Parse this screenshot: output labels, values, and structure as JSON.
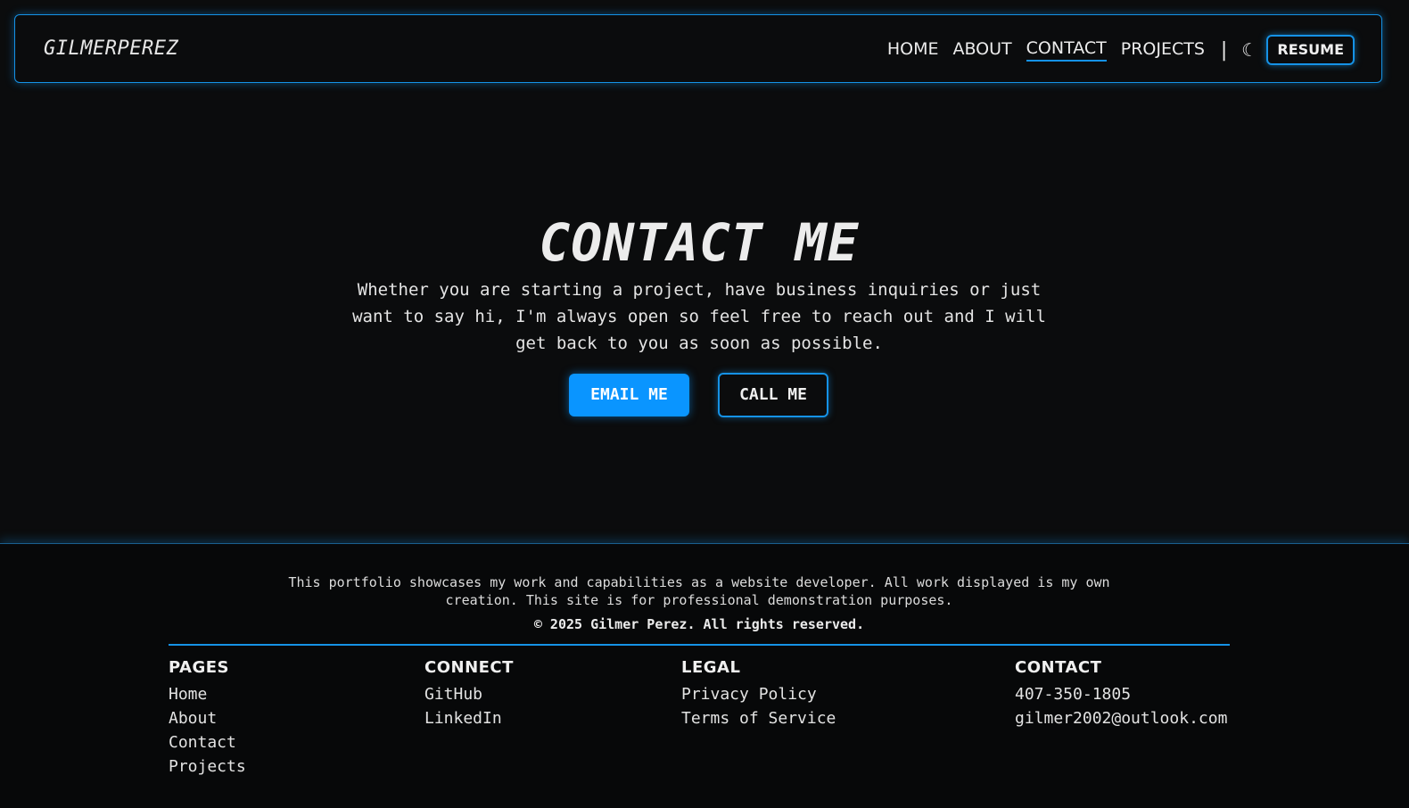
{
  "nav": {
    "brand": "GILMERPEREZ",
    "links": [
      "HOME",
      "ABOUT",
      "CONTACT",
      "PROJECTS"
    ],
    "active": "CONTACT",
    "separator": "|",
    "theme_icon": "moon-icon",
    "resume_label": "RESUME"
  },
  "hero": {
    "title": "CONTACT ME",
    "text": "Whether you are starting a project, have business inquiries or just want to say hi, I'm always open so feel free to reach out and I will get back to you as soon as possible.",
    "email_label": "EMAIL ME",
    "call_label": "CALL ME"
  },
  "footer": {
    "note": "This portfolio showcases my work and capabilities as a website developer. All work displayed is my own creation. This site is for professional demonstration purposes.",
    "copyright": "© 2025 Gilmer Perez. All rights reserved.",
    "columns": [
      {
        "heading": "PAGES",
        "items": [
          "Home",
          "About",
          "Contact",
          "Projects"
        ]
      },
      {
        "heading": "CONNECT",
        "items": [
          "GitHub",
          "LinkedIn"
        ]
      },
      {
        "heading": "LEGAL",
        "items": [
          "Privacy Policy",
          "Terms of Service"
        ]
      },
      {
        "heading": "CONTACT",
        "items": [
          "407-350-1805",
          "gilmer2002@outlook.com"
        ]
      }
    ]
  },
  "colors": {
    "accent": "#1592e6",
    "primary_button": "#0a95ff",
    "background": "#0b0c0d"
  }
}
